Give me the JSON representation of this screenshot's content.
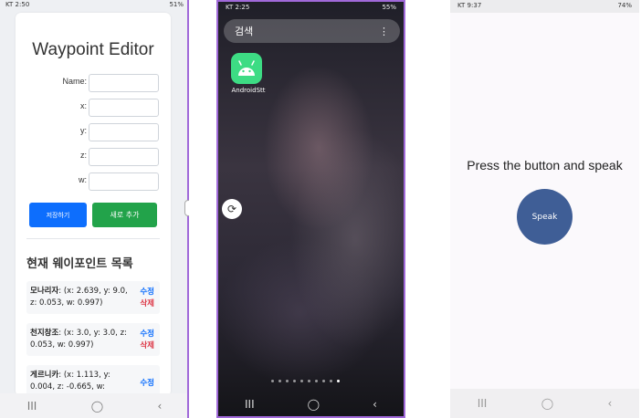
{
  "panel1": {
    "status_time": "KT 2:50",
    "status_right": "51%",
    "title": "Waypoint Editor",
    "fields": [
      {
        "label": "Name:"
      },
      {
        "label": "x:"
      },
      {
        "label": "y:"
      },
      {
        "label": "z:"
      },
      {
        "label": "w:"
      }
    ],
    "save_label": "저장하기",
    "add_label": "새로 추가",
    "list_title": "현재 웨이포인트 목록",
    "items": [
      {
        "name": "모나리자",
        "coords": ": (x: 2.639, y: 9.0, z: 0.053, w: 0.997)",
        "edit": "수정",
        "delete": "삭제"
      },
      {
        "name": "천지창조",
        "coords": ": (x: 3.0, y: 3.0, z: 0.053, w: 0.997)",
        "edit": "수정",
        "delete": "삭제"
      },
      {
        "name": "게르니카",
        "coords": ": (x: 1.113, y: 0.004, z: -0.665, w:",
        "edit": "수정"
      }
    ],
    "nav": {
      "recents": "III",
      "home": "◯",
      "back": "‹"
    }
  },
  "panel2": {
    "status_time": "KT 2:25",
    "status_right": "55%",
    "search_label": "검색",
    "menu_icon": "⋮",
    "app_label": "AndroidStt",
    "rotate_icon": "⟳",
    "page_dots": 10,
    "active_dot": 10,
    "nav": {
      "recents": "III",
      "home": "◯",
      "back": "‹"
    }
  },
  "panel3": {
    "status_time": "KT 9:37",
    "status_right": "74%",
    "prompt": "Press the button and speak",
    "speak_label": "Speak",
    "nav": {
      "recents": "III",
      "home": "◯",
      "back": "‹"
    }
  },
  "colors": {
    "primary_blue": "#0d6efd",
    "success_green": "#22a34a",
    "danger_red": "#dc3545",
    "speak_button": "#3f5e96",
    "android_green": "#3ddc84",
    "split_accent": "#a069d9"
  }
}
